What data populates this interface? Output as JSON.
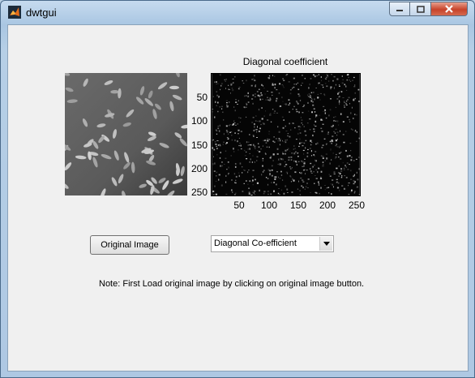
{
  "window": {
    "title": "dwtgui",
    "minimize_icon": "minimize-icon",
    "maximize_icon": "maximize-icon",
    "close_icon": "close-icon",
    "app_icon": "matlab-icon"
  },
  "axes_left": {
    "content": "rice grains grayscale image"
  },
  "axes_right": {
    "title": "Diagonal coefficient",
    "y_ticks": [
      "50",
      "100",
      "150",
      "200",
      "250"
    ],
    "x_ticks": [
      "50",
      "100",
      "150",
      "200",
      "250"
    ]
  },
  "controls": {
    "original_button_label": "Original Image",
    "coefficient_select_value": "Diagonal Co-efficient",
    "dropdown_icon": "chevron-down-icon"
  },
  "note": "Note: First Load original image by clicking on original image button.",
  "colors": {
    "panel_bg": "#f0f0f0",
    "close_red": "#c7432a",
    "frame_blue": "#b9cfe3"
  }
}
